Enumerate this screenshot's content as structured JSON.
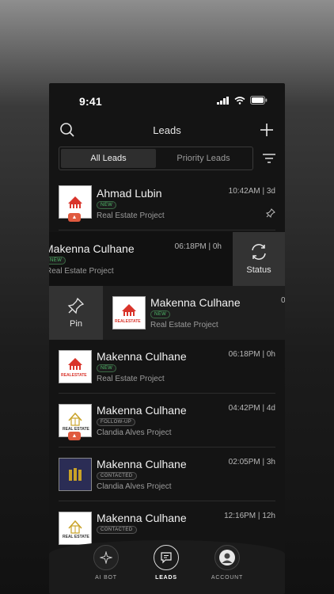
{
  "status_bar": {
    "time": "9:41"
  },
  "header": {
    "title": "Leads"
  },
  "tabs": [
    {
      "label": "All Leads",
      "active": true
    },
    {
      "label": "Priority Leads",
      "active": false
    }
  ],
  "leads": [
    {
      "name": "Ahmad Lubin",
      "badge": "NEW",
      "project": "Real Estate Project",
      "time": "10:42AM",
      "age": "3d",
      "pinned": true,
      "logo": "real-estate-red"
    },
    {
      "name": "Makenna Culhane",
      "badge": "NEW",
      "project": "Real Estate Project",
      "time": "06:18PM",
      "age": "0h",
      "logo": "real-estate-red",
      "swipe_action": "Status"
    },
    {
      "name": "Makenna Culhane",
      "badge": "NEW",
      "project": "Real Estate Project",
      "time": "0",
      "logo": "real-estate-red",
      "swipe_action": "Pin"
    },
    {
      "name": "Makenna Culhane",
      "badge": "NEW",
      "project": "Real Estate Project",
      "time": "06:18PM",
      "age": "0h",
      "logo": "real-estate-red"
    },
    {
      "name": "Makenna Culhane",
      "badge": "FOLLOW-UP",
      "project": "Clandia Alves Project",
      "time": "04:42PM",
      "age": "4d",
      "logo": "real-estate-gold"
    },
    {
      "name": "Makenna Culhane",
      "badge": "CONTACTED",
      "project": "Clandia Alves Project",
      "time": "02:05PM",
      "age": "3h",
      "logo": "m-monogram"
    },
    {
      "name": "Makenna Culhane",
      "badge": "CONTACTED",
      "project": "",
      "time": "12:16PM",
      "age": "12h",
      "logo": "real-estate-gold"
    }
  ],
  "logo_texts": {
    "red": "REALESTATE",
    "gold": "REAL ESTATE"
  },
  "time_sep": "|",
  "tabbar": [
    {
      "label": "AI BOT",
      "icon": "sparkle-icon"
    },
    {
      "label": "LEADS",
      "icon": "chat-icon",
      "active": true
    },
    {
      "label": "ACCOUNT",
      "icon": "avatar"
    }
  ],
  "colors": {
    "background": "#141414",
    "new_badge": "#4fbf6a",
    "fire": "#e05a3f",
    "logo_red": "#d9342b",
    "logo_gold": "#c9a227"
  }
}
